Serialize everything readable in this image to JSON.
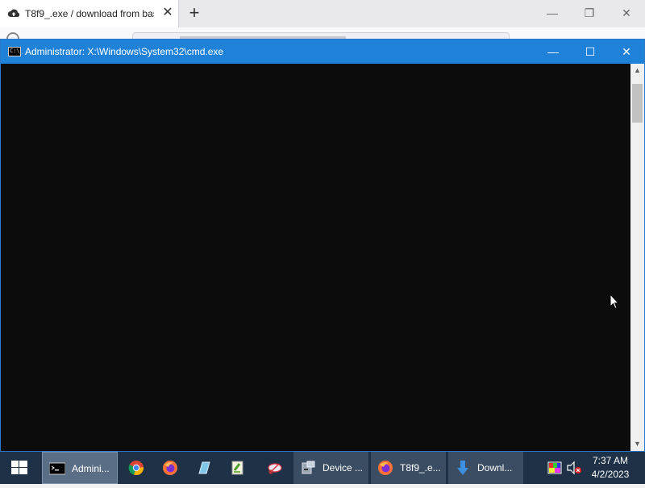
{
  "browser": {
    "tab_title": "T8f9_.exe / download from bas",
    "tab_close": "✕",
    "new_tab": "+",
    "minimize": "—",
    "restore": "❐",
    "close": "✕"
  },
  "cmd": {
    "title": "Administrator: X:\\Windows\\System32\\cmd.exe",
    "icon_text": "C:\\_",
    "minimize": "—",
    "maximize": "☐",
    "close": "✕",
    "scroll_up": "▲",
    "scroll_down": "▼"
  },
  "taskbar": {
    "items": [
      {
        "label": "Admini...",
        "icon": "cmd-icon",
        "state": "active"
      },
      {
        "label": "Device ...",
        "icon": "device-manager-icon",
        "state": "open"
      },
      {
        "label": "T8f9_.e...",
        "icon": "firefox-icon",
        "state": "open"
      },
      {
        "label": "Downl...",
        "icon": "download-icon",
        "state": "open"
      }
    ],
    "pinned": [
      "chrome-icon",
      "firefox-icon",
      "notepad-icon",
      "notepad-plus-icon",
      "scissors-icon"
    ],
    "clock": {
      "time": "7:37 AM",
      "date": "4/2/2023"
    }
  },
  "colors": {
    "cmd_title_bar": "#1f82d8",
    "cmd_background": "#0c0c0c",
    "taskbar": "#1e3147"
  }
}
